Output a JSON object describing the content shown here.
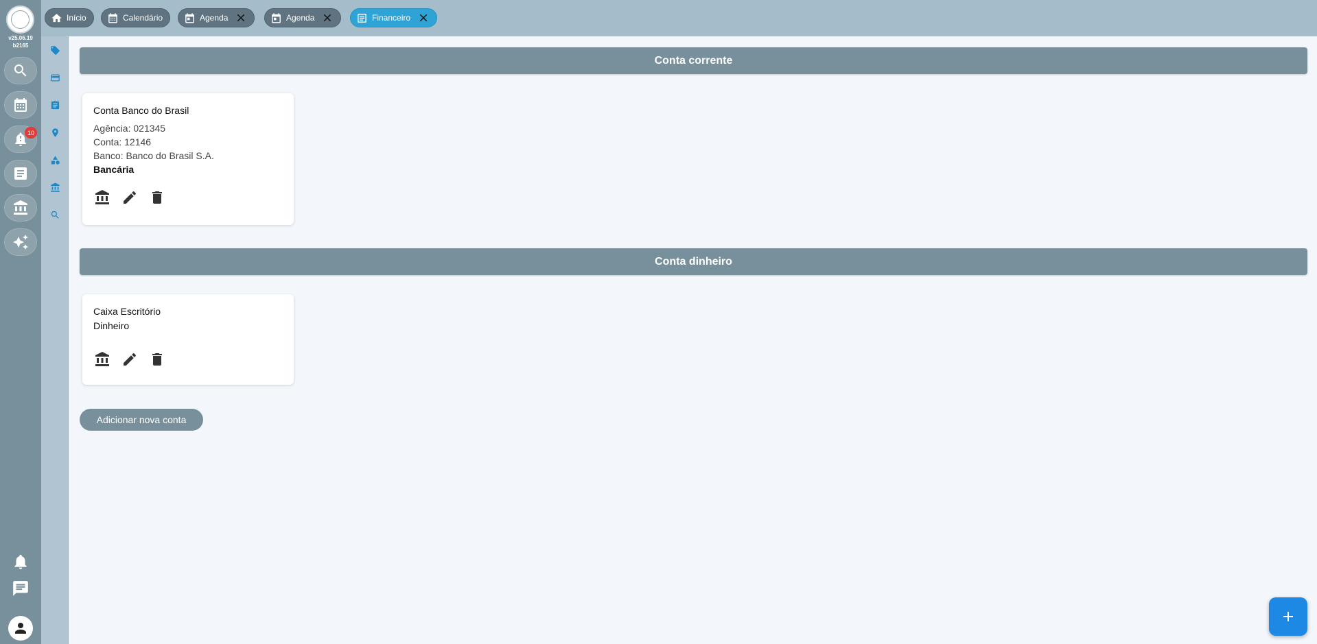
{
  "app": {
    "version": "v25.06.19",
    "build": "b2165"
  },
  "rail": {
    "items": [
      {
        "icon": "search-icon"
      },
      {
        "icon": "calendar-icon"
      },
      {
        "icon": "notification-alert-icon",
        "badge": "10"
      },
      {
        "icon": "document-icon"
      },
      {
        "icon": "bank-icon"
      },
      {
        "icon": "sparkle-icon"
      }
    ],
    "bottom": [
      "bell-icon",
      "chat-icon",
      "user-avatar-icon"
    ]
  },
  "subrail": {
    "icons": [
      "tag-icon",
      "card-icon",
      "clipboard-icon",
      "location-pin-icon",
      "shapes-icon",
      "bank-icon",
      "search-icon"
    ]
  },
  "tabs": [
    {
      "label": "Início",
      "icon": "home-icon",
      "closable": false,
      "active": false
    },
    {
      "label": "Calendário",
      "icon": "calendar-icon",
      "closable": false,
      "active": false
    },
    {
      "label": "Agenda",
      "icon": "calendar-event-icon",
      "closable": true,
      "active": false
    },
    {
      "label": "Agenda",
      "icon": "calendar-event-icon",
      "closable": true,
      "active": false
    },
    {
      "label": "Financeiro",
      "icon": "document-icon",
      "closable": true,
      "active": true
    }
  ],
  "sections": [
    {
      "title": "Conta corrente",
      "cards": [
        {
          "name": "Conta Banco do Brasil",
          "lines": [
            "Agência: 021345",
            "Conta: 12146",
            "Banco: Banco do Brasil S.A."
          ],
          "type": "Bancária"
        }
      ]
    },
    {
      "title": "Conta dinheiro",
      "cards": [
        {
          "name": "Caixa Escritório",
          "type": "Dinheiro"
        }
      ]
    }
  ],
  "add_button": "Adicionar nova conta",
  "fab_icon": "plus-icon",
  "colors": {
    "accent": "#1e88e5",
    "header": "#78909c",
    "active_tab": "#2fa3d5",
    "badge": "#e53935"
  }
}
